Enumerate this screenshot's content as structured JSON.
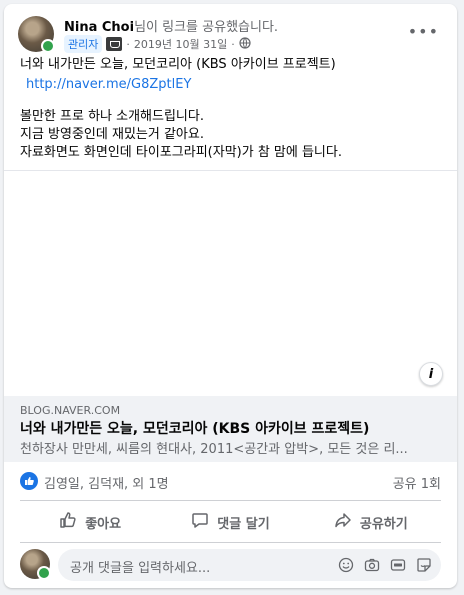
{
  "post": {
    "author": "Nina Choi",
    "header_suffix": "님이 링크를 공유했습니다.",
    "role_badge": "관리자",
    "date": "2019년 10월 31일",
    "separator": "·",
    "text_lines": [
      "너와 내가만든 오늘, 모던코리아 (KBS 아카이브 프로젝트)",
      "볼만한 프로 하나 소개해드립니다.",
      "지금 방영중인데 재밌는거 같아요.",
      "자료화면도 화면인데 타이포그라피(자막)가 참 맘에 듭니다."
    ],
    "link": "http://naver.me/G8ZptlEY"
  },
  "link_preview": {
    "domain": "BLOG.NAVER.COM",
    "title": "너와 내가만든 오늘, 모던코리아 (KBS 아카이브 프로젝트)",
    "description": "천하장사 만만세, 씨름의 현대사, 2011<공간과 압박>, 모든 것은 리..."
  },
  "stats": {
    "likers": "김영일, 김덕재, 외 1명",
    "shares": "공유 1회"
  },
  "actions": {
    "like": "좋아요",
    "comment": "댓글 달기",
    "share": "공유하기"
  },
  "comment_box": {
    "placeholder": "공개 댓글을 입력하세요..."
  },
  "colors": {
    "accent": "#1b74e4",
    "online": "#31a24c",
    "secondary_text": "#65676b"
  }
}
